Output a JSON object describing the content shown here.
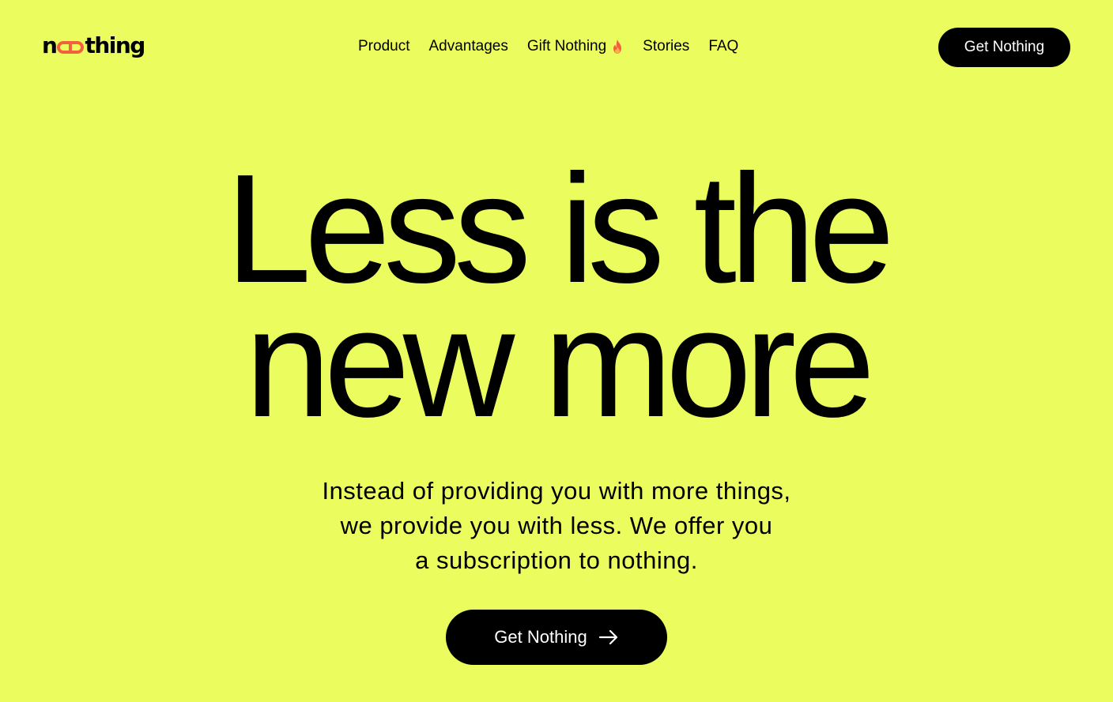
{
  "header": {
    "logo_text_before": "n",
    "logo_text_after": "thing",
    "nav": [
      {
        "label": "Product"
      },
      {
        "label": "Advantages"
      },
      {
        "label": "Gift Nothing",
        "icon": "fire-icon"
      },
      {
        "label": "Stories"
      },
      {
        "label": "FAQ"
      }
    ],
    "cta_label": "Get Nothing"
  },
  "hero": {
    "title_line1": "Less is the",
    "title_line2": "new more",
    "subtitle_line1": "Instead of providing you with more things,",
    "subtitle_line2": "we provide you with less. We offer you",
    "subtitle_line3": "a subscription to nothing.",
    "cta_label": "Get Nothing",
    "cta_icon": "arrow-right-icon"
  },
  "colors": {
    "background": "#ebfc5e",
    "text": "#000000",
    "accent": "#f2603c",
    "button_bg": "#000000",
    "button_text": "#ffffff"
  }
}
